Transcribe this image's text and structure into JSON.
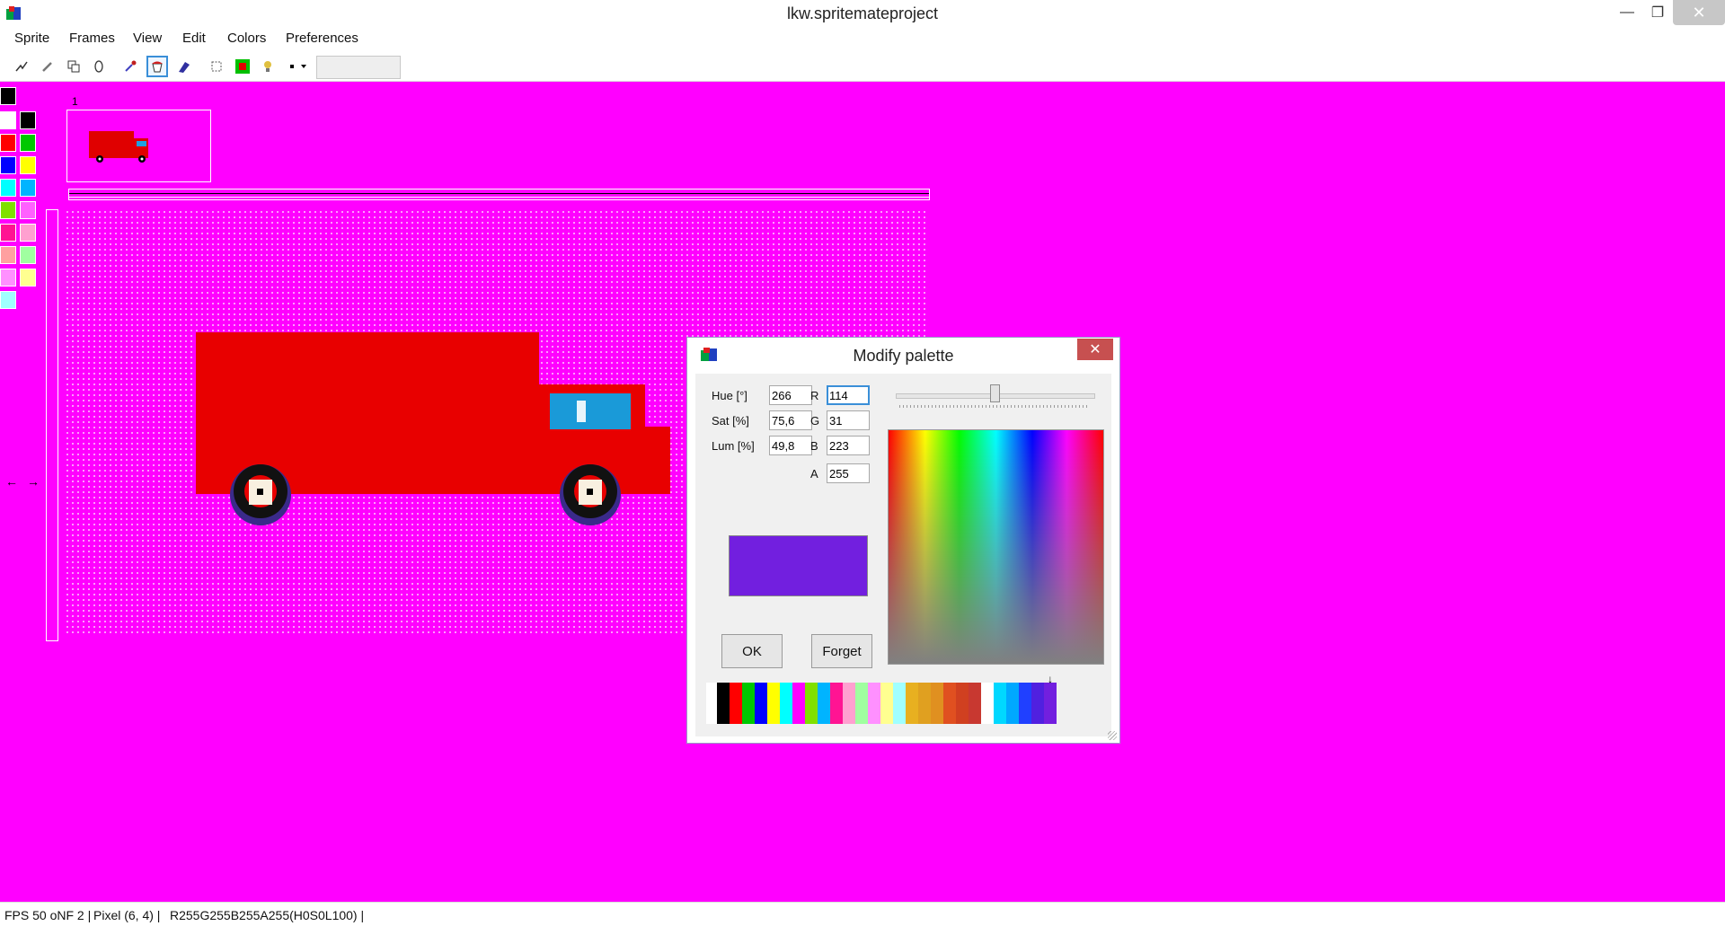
{
  "window": {
    "title": "lkw.spritemateproject",
    "minimize_glyph": "—",
    "maximize_glyph": "❐",
    "close_glyph": "✕"
  },
  "menu": [
    "Sprite",
    "Frames",
    "View",
    "Edit",
    "Colors",
    "Preferences"
  ],
  "toolbar": {
    "tools": [
      "lasso-icon",
      "pencil-icon",
      "copy-frames-icon",
      "ellipse-icon",
      "color-picker-icon",
      "bucket-fill-icon",
      "eraser-icon",
      "selection-icon",
      "color-swap-icon",
      "bulb-icon",
      "brush-size-icon"
    ],
    "selected_tool": "bucket-fill-icon"
  },
  "side_palette": {
    "top_color": "#000000",
    "colors": [
      "#ffffff",
      "#000000",
      "#ff0000",
      "#00c800",
      "#0000ff",
      "#ffff00",
      "#00ffff",
      "#00b4ff",
      "#80e000",
      "#ff60ff",
      "#ff1493",
      "#ffa0d0",
      "#ffa0a0",
      "#a0ffa0",
      "#ff90ff",
      "#ffff90",
      "#a0ffff"
    ]
  },
  "frames": {
    "frame_number": "1"
  },
  "navigation": {
    "prev_glyph": "←",
    "next_glyph": "→"
  },
  "statusbar": {
    "fps": "FPS 50 oNF 2 |",
    "pixel": "Pixel (6, 4) |",
    "color": "R255G255B255A255(H0S0L100) |"
  },
  "dialog": {
    "title": "Modify palette",
    "close_glyph": "✕",
    "labels": {
      "hue": "Hue [°]",
      "sat": "Sat [%]",
      "lum": "Lum [%]",
      "r": "R",
      "g": "G",
      "b": "B",
      "a": "A"
    },
    "values": {
      "hue": "266",
      "sat": "75,6",
      "lum": "49,8",
      "r": "114",
      "g": "31",
      "b": "223",
      "a": "255"
    },
    "preview_color": "#721fdf",
    "ok_label": "OK",
    "forget_label": "Forget",
    "marker_glyph": "↓",
    "palette_strip": [
      "#000000",
      "#ff0000",
      "#00c800",
      "#0000ff",
      "#ffff00",
      "#00ffff",
      "#ff00ff",
      "#80e000",
      "#00b4ff",
      "#ff1493",
      "#ffa0d0",
      "#a0ffa0",
      "#ff90ff",
      "#ffff90",
      "#a0ffff",
      "#e8b020",
      "#e0a020",
      "#e09020",
      "#e05020",
      "#d04020",
      "#c83830"
    ],
    "custom_strip": [
      "#00d8ff",
      "#00a8ff",
      "#2040ff",
      "#5020e0",
      "#721fdf"
    ]
  }
}
